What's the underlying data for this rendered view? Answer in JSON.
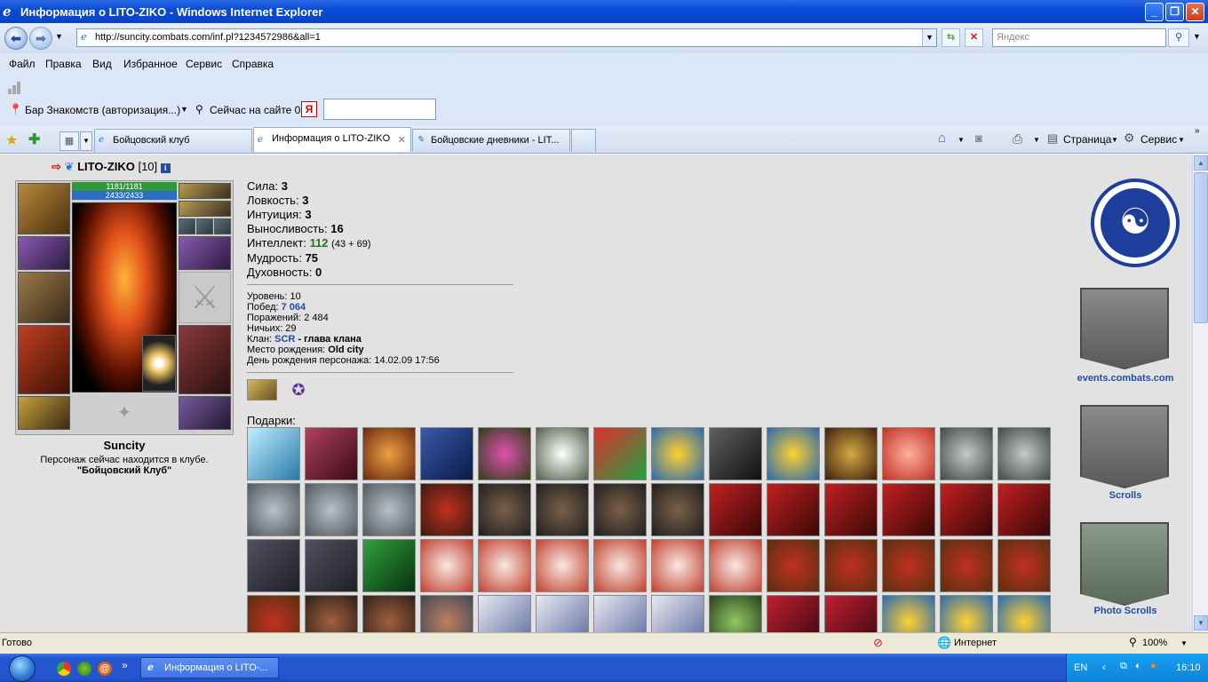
{
  "window": {
    "title": "Информация о LITO-ZIKO - Windows Internet Explorer"
  },
  "address": {
    "url": "http://suncity.combats.com/inf.pl?1234572986&all=1"
  },
  "search": {
    "placeholder": "Яндекс"
  },
  "menu": [
    "Файл",
    "Правка",
    "Вид",
    "Избранное",
    "Сервис",
    "Справка"
  ],
  "toolbar": {
    "bar_label": "Бар Знакомств (авторизация...)",
    "online_label": "Сейчас на сайте 0"
  },
  "tabs": [
    {
      "label": "Бойцовский клуб",
      "active": false
    },
    {
      "label": "Информация о LITO-ZIKO",
      "active": true
    },
    {
      "label": "Бойцовские дневники - LIT...",
      "active": false
    }
  ],
  "commands": {
    "page": "Страница",
    "tools": "Сервис"
  },
  "character": {
    "name": "LITO-ZIKO",
    "level_tag": "[10]",
    "hp": "1181/1181",
    "mp": "2433/2433",
    "city": "Suncity",
    "presence": "Персонаж сейчас находится в клубе.",
    "place": "\"Бойцовский Клуб\""
  },
  "stats": [
    {
      "label": "Сила:",
      "value": "3"
    },
    {
      "label": "Ловкость:",
      "value": "3"
    },
    {
      "label": "Интуиция:",
      "value": "3"
    },
    {
      "label": "Выносливость:",
      "value": "16"
    },
    {
      "label": "Интеллект:",
      "value": "112",
      "extra": "(43 + 69)"
    },
    {
      "label": "Мудрость:",
      "value": "75"
    },
    {
      "label": "Духовность:",
      "value": "0"
    }
  ],
  "info": {
    "level": "Уровень: 10",
    "wins_label": "Побед:",
    "wins": "7 064",
    "losses": "Поражений: 2 484",
    "draws": "Ничьих: 29",
    "clan_label": "Клан:",
    "clan": "SCR",
    "clan_role": "- глава клана",
    "birthplace_label": "Место рождения:",
    "birthplace": "Old city",
    "birthday": "День рождения персонажа: 14.02.09 17:56"
  },
  "gifts_label": "Подарки:",
  "gifts": [
    "cyan",
    "maroon",
    "orange",
    "navy",
    "pink",
    "white",
    "jester",
    "bell",
    "accordion",
    "bell",
    "helmet",
    "crystal",
    "trophy",
    "trophy",
    "statue",
    "statue",
    "statue",
    "bear",
    "spider",
    "spider",
    "spider",
    "spider",
    "banner",
    "banner",
    "banner",
    "banner",
    "banner",
    "banner",
    "cloak",
    "cloak",
    "green",
    "teddy",
    "teddy",
    "teddy",
    "teddy",
    "teddy",
    "teddy",
    "horse",
    "horse",
    "horse",
    "horse",
    "horse",
    "horse",
    "armor",
    "armor",
    "vase",
    "tube",
    "tube",
    "tube",
    "tube",
    "frog",
    "book",
    "book",
    "bell",
    "bell",
    "bell"
  ],
  "banners": {
    "events": "events.combats.com",
    "scrolls": "Scrolls",
    "photo": "Photo Scrolls"
  },
  "status": {
    "left": "Готово",
    "zone": "Интернет",
    "zoom": "100%"
  },
  "taskbar": {
    "task": "Информация о LITO-...",
    "lang": "EN",
    "time": "16:10"
  }
}
